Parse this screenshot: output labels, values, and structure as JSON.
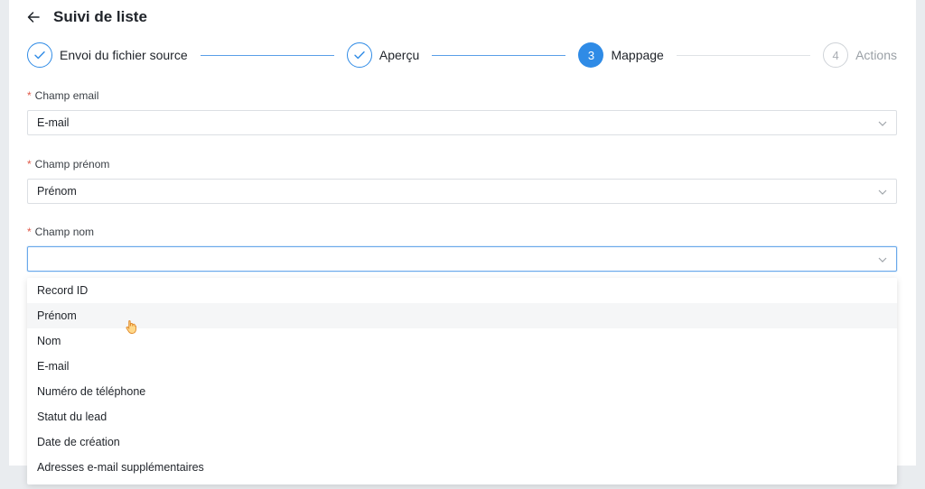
{
  "header": {
    "title": "Suivi de liste"
  },
  "steps": [
    {
      "label": "Envoi du fichier source",
      "state": "done"
    },
    {
      "label": "Aperçu",
      "state": "done"
    },
    {
      "number": "3",
      "label": "Mappage",
      "state": "active"
    },
    {
      "number": "4",
      "label": "Actions",
      "state": "todo"
    }
  ],
  "fields": {
    "email": {
      "label": "Champ email",
      "required": "*",
      "value": "E-mail"
    },
    "prenom": {
      "label": "Champ prénom",
      "required": "*",
      "value": "Prénom"
    },
    "nom": {
      "label": "Champ nom",
      "required": "*",
      "value": ""
    }
  },
  "dropdown": {
    "options": [
      "Record ID",
      "Prénom",
      "Nom",
      "E-mail",
      "Numéro de téléphone",
      "Statut du lead",
      "Date de création",
      "Adresses e-mail supplémentaires"
    ],
    "hovered_index": 1
  },
  "colors": {
    "accent": "#2f8be6",
    "required": "#e05a4a"
  }
}
